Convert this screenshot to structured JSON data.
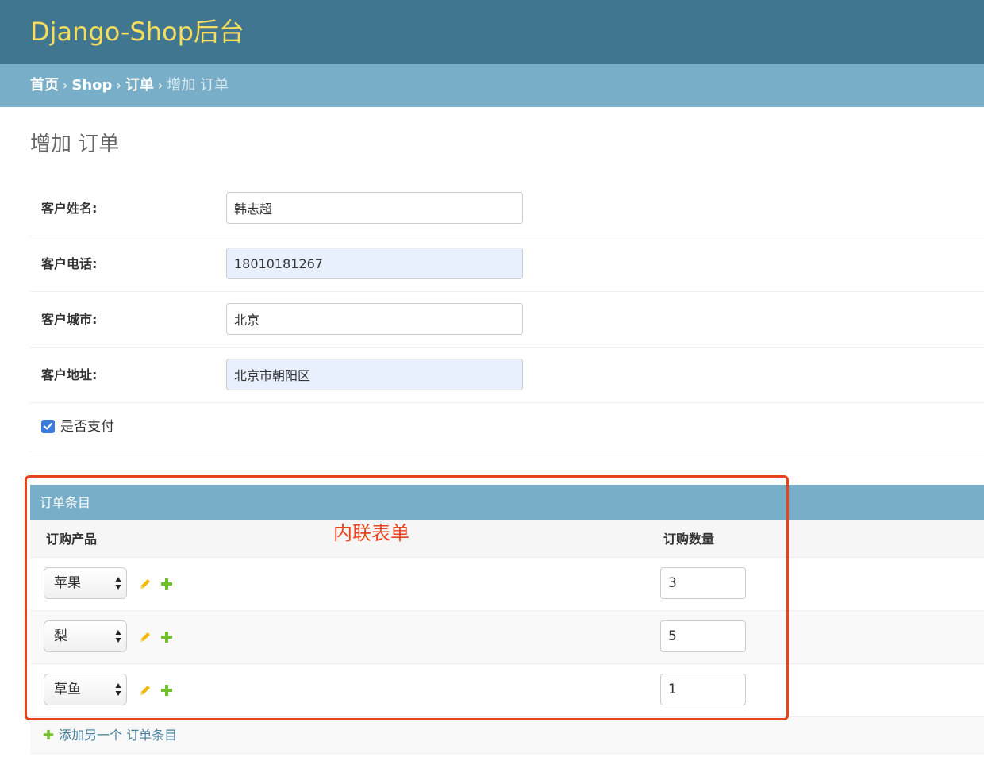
{
  "header": {
    "brand": "Django-Shop后台"
  },
  "breadcrumbs": {
    "home": "首页",
    "sep": "›",
    "app": "Shop",
    "model": "订单",
    "current": "增加 订单"
  },
  "page": {
    "title": "增加 订单"
  },
  "fields": [
    {
      "label": "客户姓名:",
      "value": "韩志超"
    },
    {
      "label": "客户电话:",
      "value": "18010181267"
    },
    {
      "label": "客户城市:",
      "value": "北京"
    },
    {
      "label": "客户地址:",
      "value": "北京市朝阳区"
    }
  ],
  "paid": {
    "label": "是否支付",
    "checked": true
  },
  "inline": {
    "title": "订单条目",
    "col_product": "订购产品",
    "col_quantity": "订购数量",
    "annotation": "内联表单",
    "rows": [
      {
        "product": "苹果",
        "quantity": "3"
      },
      {
        "product": "梨",
        "quantity": "5"
      },
      {
        "product": "草鱼",
        "quantity": "1"
      }
    ],
    "add_label": "添加另一个 订单条目"
  },
  "colors": {
    "header": "#417690",
    "breadcrumb": "#79aec8",
    "brand": "#f5dd5d",
    "annotation": "#e8431f",
    "add": "#70bf2b",
    "edit": "#efb80b"
  },
  "icons": [
    "pencil-icon",
    "plus-icon",
    "checkmark-icon",
    "select-arrows-icon"
  ]
}
